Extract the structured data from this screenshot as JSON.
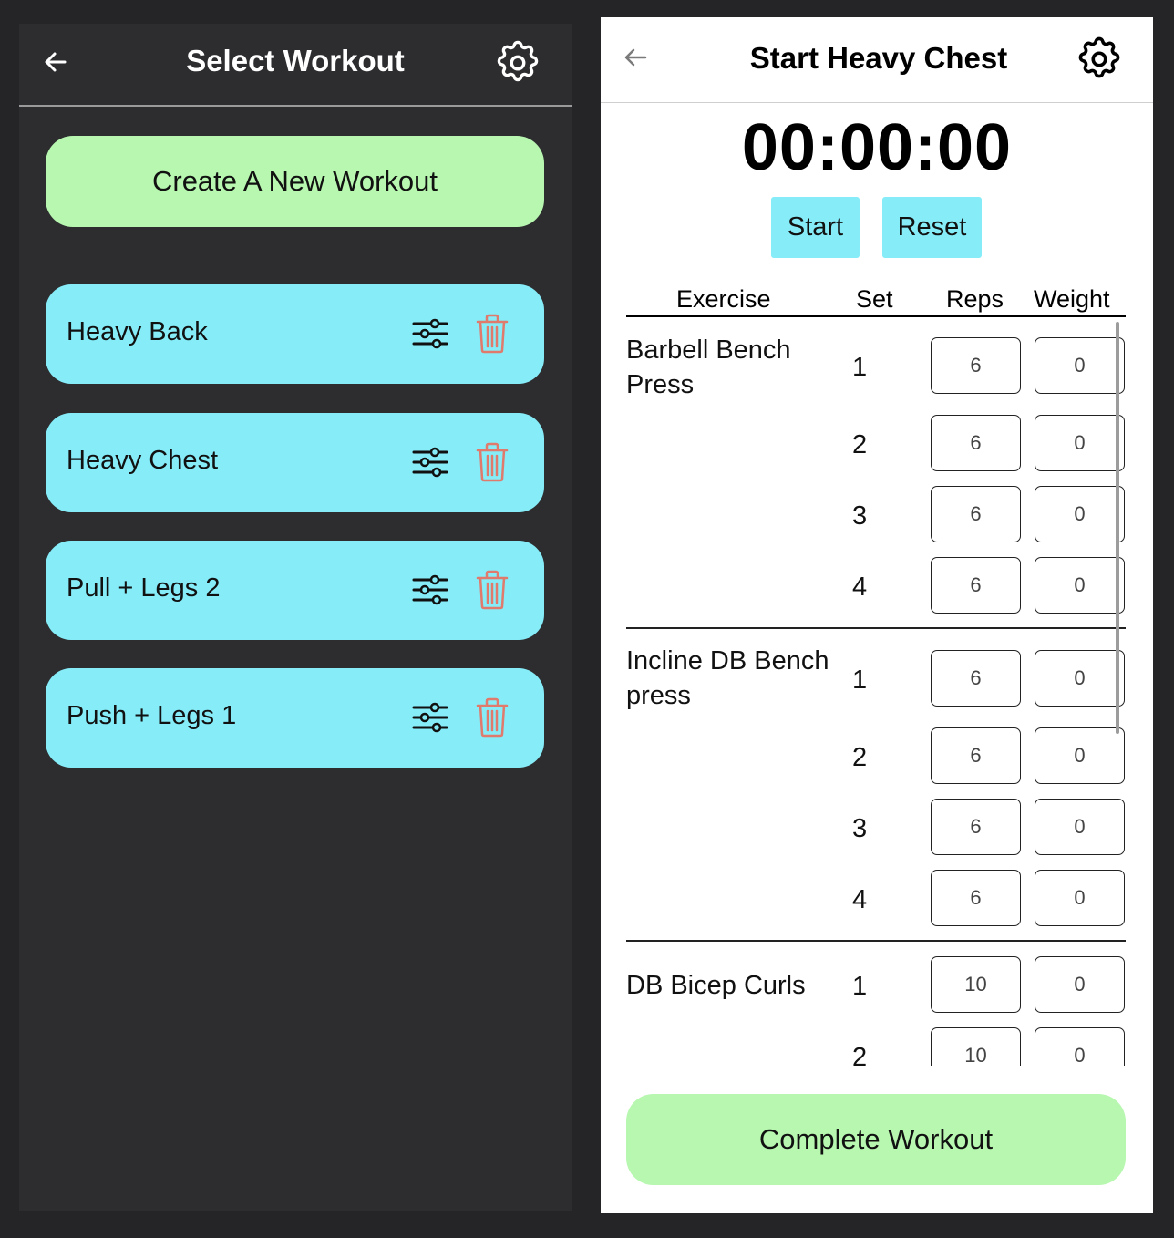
{
  "left_screen": {
    "title": "Select Workout",
    "create_label": "Create A New Workout",
    "workouts": [
      {
        "name": "Heavy Back"
      },
      {
        "name": "Heavy Chest"
      },
      {
        "name": "Pull + Legs 2"
      },
      {
        "name": "Push + Legs 1"
      }
    ],
    "icons": {
      "back": "arrow-left-icon",
      "settings": "gear-icon",
      "edit": "sliders-icon",
      "delete": "trash-icon"
    },
    "colors": {
      "background": "#2d2d30",
      "create_button": "#b7f7b0",
      "workout_card": "#85ecf8",
      "delete_icon": "#e07a6c"
    }
  },
  "right_screen": {
    "title": "Start Heavy Chest",
    "timer": "00:00:00",
    "start_label": "Start",
    "reset_label": "Reset",
    "columns": {
      "exercise": "Exercise",
      "set": "Set",
      "reps": "Reps",
      "weight": "Weight"
    },
    "exercises": [
      {
        "name": "Barbell Bench Press",
        "sets": [
          {
            "set": "1",
            "reps": "6",
            "weight": "0"
          },
          {
            "set": "2",
            "reps": "6",
            "weight": "0"
          },
          {
            "set": "3",
            "reps": "6",
            "weight": "0"
          },
          {
            "set": "4",
            "reps": "6",
            "weight": "0"
          }
        ]
      },
      {
        "name": "Incline DB Bench press",
        "sets": [
          {
            "set": "1",
            "reps": "6",
            "weight": "0"
          },
          {
            "set": "2",
            "reps": "6",
            "weight": "0"
          },
          {
            "set": "3",
            "reps": "6",
            "weight": "0"
          },
          {
            "set": "4",
            "reps": "6",
            "weight": "0"
          }
        ]
      },
      {
        "name": "DB Bicep Curls",
        "sets": [
          {
            "set": "1",
            "reps": "10",
            "weight": "0"
          },
          {
            "set": "2",
            "reps": "10",
            "weight": "0"
          }
        ]
      }
    ],
    "complete_label": "Complete Workout",
    "icons": {
      "back": "arrow-left-icon",
      "settings": "gear-icon"
    },
    "colors": {
      "timer_buttons": "#85ecf8",
      "complete_button": "#b7f7b0"
    }
  }
}
